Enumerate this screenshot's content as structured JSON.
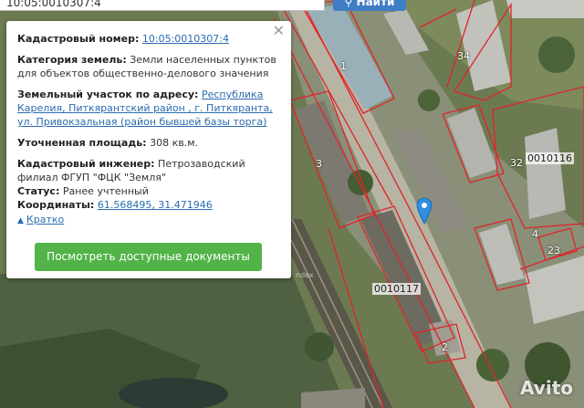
{
  "search": {
    "value": "10:05:0010307:4",
    "button_label": "Найти"
  },
  "popup": {
    "cadastral_number_label": "Кадастровый номер:",
    "cadastral_number": "10:05:0010307:4",
    "land_category_label": "Категория земель:",
    "land_category": "Земли населенных пунктов для объектов общественно-делового значения",
    "address_label": "Земельный участок по адресу:",
    "address": "Республика Карелия, Питкярантский район , г. Питкяранта, ул. Привокзальная (район бывшей базы торга)",
    "area_label": "Уточненная площадь:",
    "area": "308 кв.м.",
    "engineer_label": "Кадастровый инженер:",
    "engineer": "Петрозаводский филиал ФГУП \"ФЦК \"Земля\"",
    "status_label": "Статус:",
    "status": "Ранее учтенный",
    "coords_label": "Координаты:",
    "coords": "61.568495, 31.471946",
    "brief_link": "Кратко",
    "docs_button": "Посмотреть доступные документы",
    "close_icon": "close-icon"
  },
  "map": {
    "building_labels": [
      "1",
      "3",
      "34",
      "32",
      "23",
      "2",
      "4"
    ],
    "parcel_labels": [
      "0010116",
      "0010117"
    ],
    "yandex_mark": "ndex",
    "marker_color": "#2f8ee0",
    "boundary_color": "#e0242a"
  },
  "watermark": "Avito"
}
